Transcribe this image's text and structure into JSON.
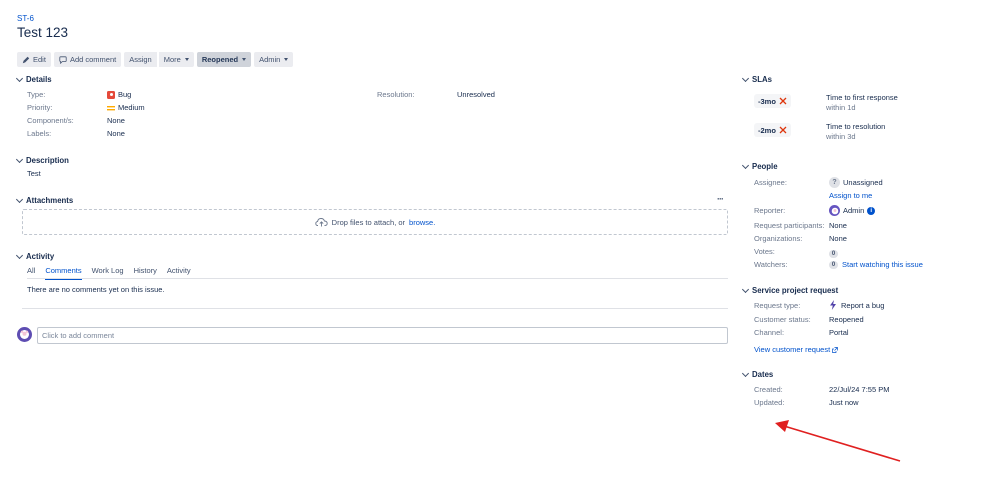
{
  "issue": {
    "key": "ST-6",
    "title": "Test 123"
  },
  "toolbar": {
    "edit": "Edit",
    "add_comment": "Add comment",
    "assign": "Assign",
    "more": "More",
    "status": "Reopened",
    "admin": "Admin"
  },
  "details": {
    "heading": "Details",
    "type_label": "Type:",
    "type_value": "Bug",
    "priority_label": "Priority:",
    "priority_value": "Medium",
    "components_label": "Component/s:",
    "components_value": "None",
    "labels_label": "Labels:",
    "labels_value": "None",
    "resolution_label": "Resolution:",
    "resolution_value": "Unresolved"
  },
  "description": {
    "heading": "Description",
    "text": "Test"
  },
  "attachments": {
    "heading": "Attachments",
    "drop_text": "Drop files to attach, or",
    "browse": "browse.",
    "more": "···"
  },
  "activity": {
    "heading": "Activity",
    "tabs": [
      "All",
      "Comments",
      "Work Log",
      "History",
      "Activity"
    ],
    "active_tab": "Comments",
    "empty": "There are no comments yet on this issue."
  },
  "comment": {
    "placeholder": "Click to add comment"
  },
  "slas": {
    "heading": "SLAs",
    "items": [
      {
        "value": "-3mo",
        "name": "Time to first response",
        "goal": "within 1d"
      },
      {
        "value": "-2mo",
        "name": "Time to resolution",
        "goal": "within 3d"
      }
    ]
  },
  "people": {
    "heading": "People",
    "assignee_label": "Assignee:",
    "assignee_value": "Unassigned",
    "assign_to_me": "Assign to me",
    "reporter_label": "Reporter:",
    "reporter_value": "Admin",
    "participants_label": "Request participants:",
    "participants_value": "None",
    "orgs_label": "Organizations:",
    "orgs_value": "None",
    "votes_label": "Votes:",
    "votes_value": "0",
    "watchers_label": "Watchers:",
    "watchers_value": "0",
    "start_watching": "Start watching this issue"
  },
  "service": {
    "heading": "Service project request",
    "type_label": "Request type:",
    "type_value": "Report a bug",
    "customer_status_label": "Customer status:",
    "customer_status_value": "Reopened",
    "channel_label": "Channel:",
    "channel_value": "Portal",
    "view_link": "View customer request"
  },
  "dates": {
    "heading": "Dates",
    "created_label": "Created:",
    "created_value": "22/Jul/24 7:55 PM",
    "updated_label": "Updated:",
    "updated_value": "Just now"
  },
  "colors": {
    "link": "#0052cc",
    "bug": "#e5493a",
    "medium": "#ffab00",
    "sla_breach": "#de350b",
    "arrow": "#e02020"
  }
}
